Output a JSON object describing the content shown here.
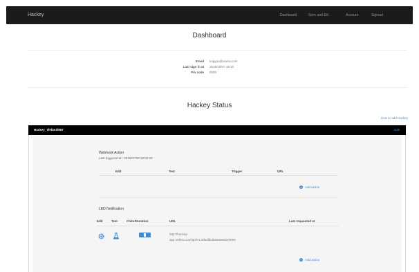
{
  "navbar": {
    "brand": "Hackey",
    "links": [
      "Dashboard",
      "Spec and Etc",
      "Account",
      "Signout"
    ]
  },
  "dashboard": {
    "title": "Dashboard",
    "email_label": "Email",
    "email_value": "kogypu@anera.com",
    "last_sign_in_label": "Last sign in at",
    "last_sign_in_value": "2015/10/07 18:10",
    "pin_code_label": "Pin code",
    "pin_code_value": "0000"
  },
  "status": {
    "title": "Hackey Status",
    "how_to_add_link": "How to add Hackey"
  },
  "device": {
    "name": "Hackey_7fef4e1f897",
    "edit_link": "Edit",
    "webhook": {
      "title": "Webhook Action",
      "last_triggered": "Last triggered at : 2015/07/08 18:02:33",
      "columns": [
        "Edit",
        "Test",
        "Trigger",
        "URL"
      ],
      "add_action": "Add action"
    },
    "led": {
      "title": "LED Notification",
      "columns": [
        "Edit",
        "Test",
        "Color/Duration",
        "URL",
        "Last requested at"
      ],
      "row": {
        "url_line1": "http://hackey-",
        "url_line2": "app.railess.com/api/v1.0/led/lb4be8500d2e0999"
      },
      "add_action": "Add action"
    }
  },
  "colors": {
    "navbar": "#1b1b1b",
    "link": "#3d8bd4",
    "panel_head": "#000000",
    "panel_body": "#f5f5f5"
  }
}
